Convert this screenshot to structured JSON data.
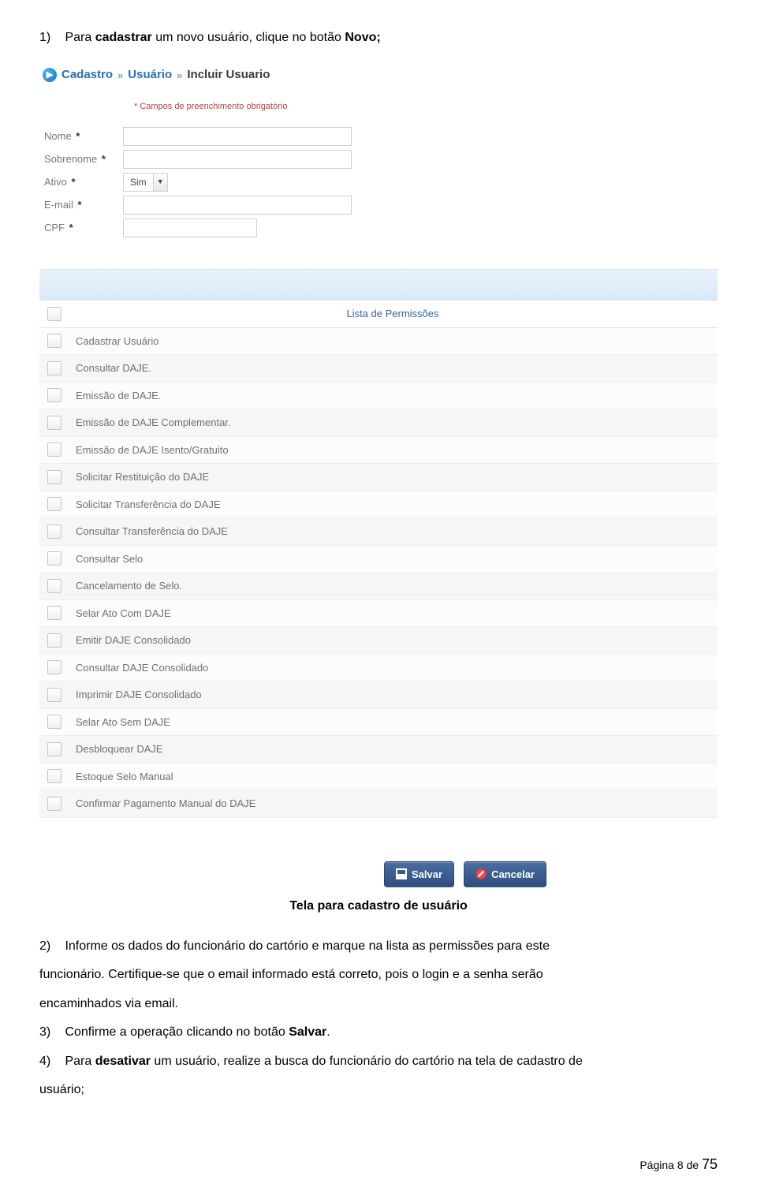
{
  "step1": {
    "num": "1)",
    "pre": "Para ",
    "bold1": "cadastrar",
    "mid": " um novo usuário, clique no botão ",
    "bold2": "Novo;"
  },
  "breadcrumb": {
    "part1": "Cadastro",
    "sep": "»",
    "part2": "Usuário",
    "current": "Incluir Usuario"
  },
  "required_note": "* Campos de preenchimento obrigatório",
  "fields": {
    "nome": {
      "label": "Nome",
      "value": ""
    },
    "sobrenome": {
      "label": "Sobrenome",
      "value": ""
    },
    "ativo": {
      "label": "Ativo",
      "value": "Sim"
    },
    "email": {
      "label": "E-mail",
      "value": ""
    },
    "cpf": {
      "label": "CPF",
      "value": ""
    }
  },
  "permissions": {
    "header": "Lista de Permissões",
    "items": [
      "Cadastrar Usuário",
      "Consultar DAJE.",
      "Emissão de DAJE.",
      "Emissão de DAJE Complementar.",
      "Emissão de DAJE Isento/Gratuito",
      "Solicitar Restituição do DAJE",
      "Solicitar Transferência do DAJE",
      "Consultar Transferência do DAJE",
      "Consultar Selo",
      "Cancelamento de Selo.",
      "Selar Ato Com DAJE",
      "Emitir DAJE Consolidado",
      "Consultar DAJE Consolidado",
      "Imprimir DAJE Consolidado",
      "Selar Ato Sem DAJE",
      "Desbloquear DAJE",
      "Estoque Selo Manual",
      "Confirmar Pagamento Manual do DAJE"
    ]
  },
  "buttons": {
    "save": "Salvar",
    "cancel": "Cancelar"
  },
  "caption": "Tela para cadastro de usuário",
  "step2": {
    "num": "2)",
    "line1": "Informe os dados do funcionário do cartório e marque na lista as permissões para este",
    "line2": "funcionário. Certifique-se que o email informado está correto, pois o login e a senha serão",
    "line3": "encaminhados via email."
  },
  "step3": {
    "num": "3)",
    "pre": "Confirme a operação clicando no botão ",
    "bold": "Salvar",
    "post": "."
  },
  "step4": {
    "num": "4)",
    "pre": "Para ",
    "bold": "desativar",
    "mid": " um usuário, realize a busca do funcionário do cartório na tela de cadastro de",
    "line2": "usuário;"
  },
  "footer": {
    "prefix": "Página ",
    "page": "8",
    "of": " de ",
    "total": "75"
  }
}
